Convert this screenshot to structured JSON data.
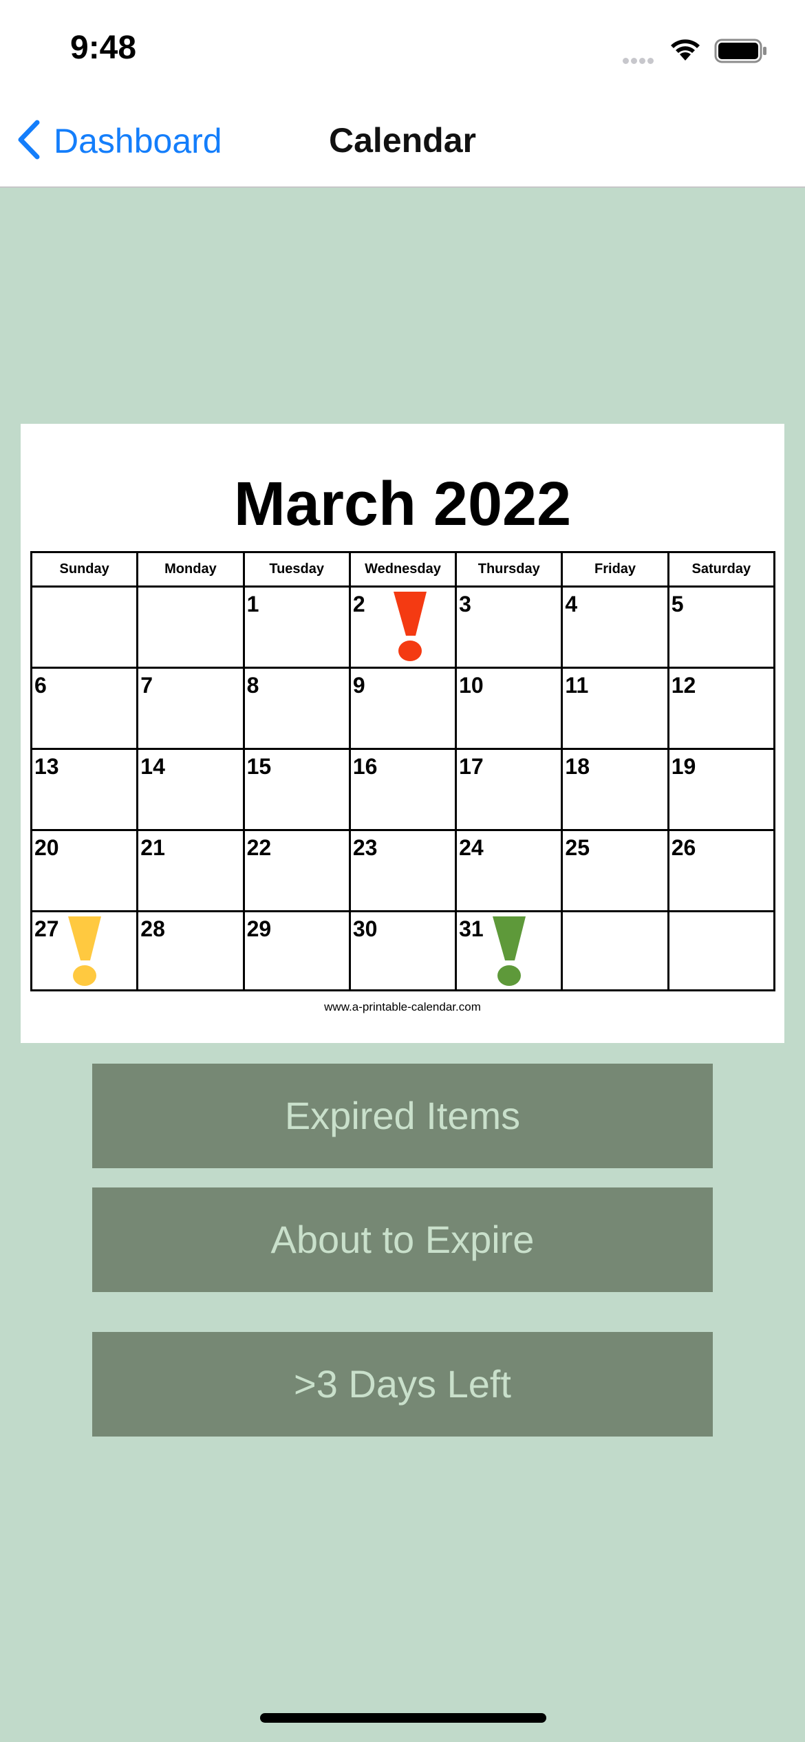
{
  "status_bar": {
    "time": "9:48"
  },
  "nav": {
    "back_label": "Dashboard",
    "title": "Calendar"
  },
  "calendar": {
    "title": "March 2022",
    "weekdays": [
      "Sunday",
      "Monday",
      "Tuesday",
      "Wednesday",
      "Thursday",
      "Friday",
      "Saturday"
    ],
    "weeks": [
      [
        "",
        "",
        "1",
        "2",
        "3",
        "4",
        "5"
      ],
      [
        "6",
        "7",
        "8",
        "9",
        "10",
        "11",
        "12"
      ],
      [
        "13",
        "14",
        "15",
        "16",
        "17",
        "18",
        "19"
      ],
      [
        "20",
        "21",
        "22",
        "23",
        "24",
        "25",
        "26"
      ],
      [
        "27",
        "28",
        "29",
        "30",
        "31",
        "",
        ""
      ]
    ],
    "footer": "www.a-printable-calendar.com",
    "marks": [
      {
        "day": "2",
        "color": "#F43A12",
        "name": "expired-mark-icon"
      },
      {
        "day": "27",
        "color": "#FFC940",
        "name": "about-to-expire-mark-icon"
      },
      {
        "day": "31",
        "color": "#5E993A",
        "name": "days-left-mark-icon"
      }
    ]
  },
  "buttons": {
    "expired": "Expired Items",
    "about_to_expire": "About to Expire",
    "days_left": ">3 Days Left"
  },
  "colors": {
    "background": "#C1DACA",
    "button": "#768874",
    "button_text": "#C9E0CB",
    "link": "#147EFB"
  }
}
